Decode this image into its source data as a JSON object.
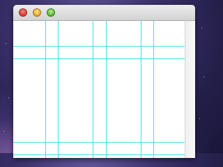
{
  "window": {
    "title": "",
    "controls": {
      "close": "close-icon",
      "minimize": "minimize-icon",
      "zoom": "zoom-icon"
    }
  },
  "colors": {
    "guide": "#41dde8",
    "close": "#e0443e",
    "minimize": "#f0b43a",
    "zoom": "#6cc24a"
  },
  "content": {
    "type": "layout-guide-grid"
  }
}
